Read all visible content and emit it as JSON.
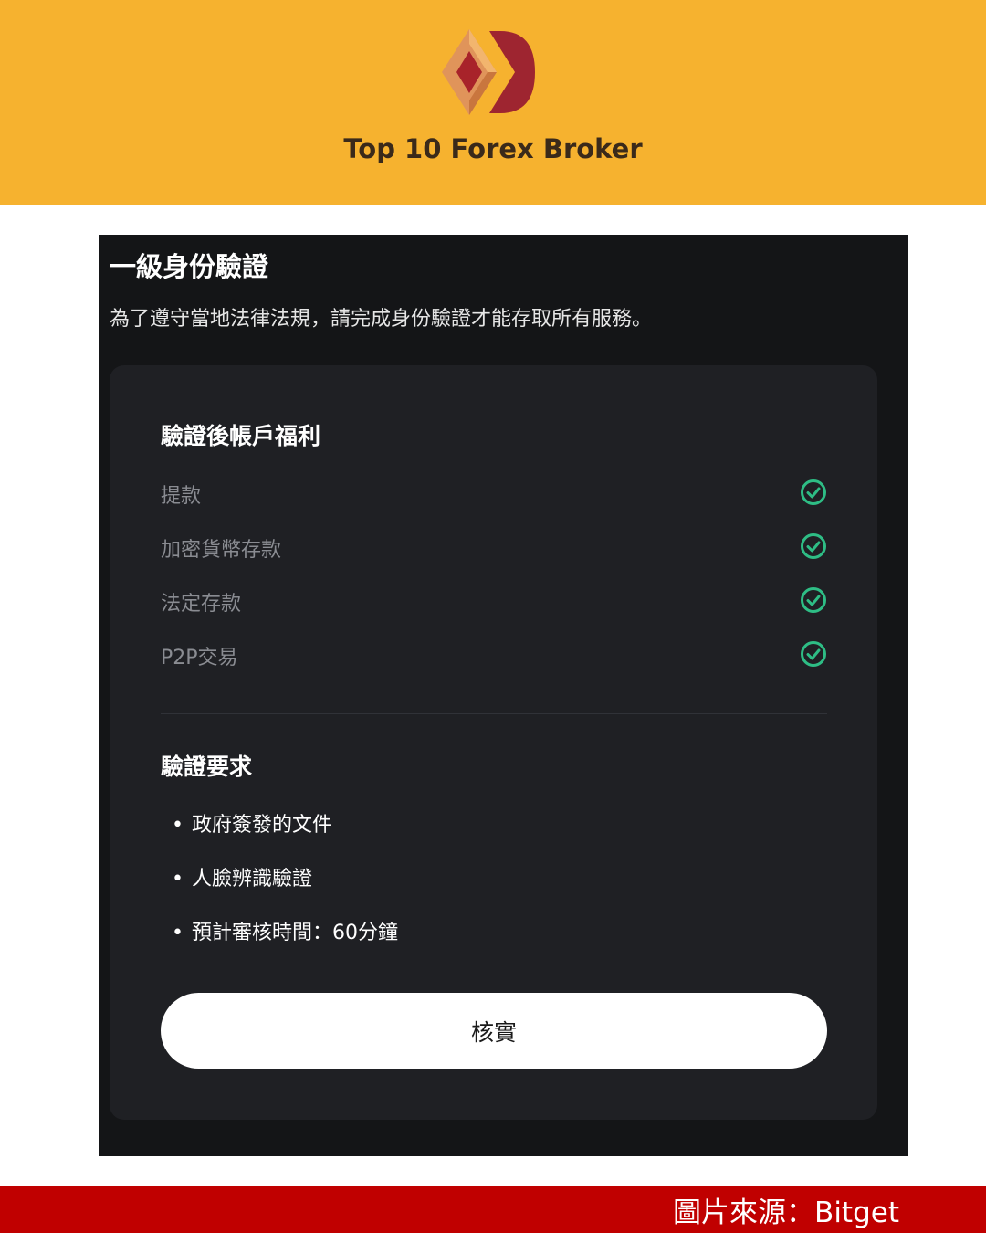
{
  "header": {
    "brand": "Top 10 Forex Broker",
    "logo_icon": "diamond-d-logo",
    "background": "#f6b22f"
  },
  "panel": {
    "title": "一級身份驗證",
    "subtitle": "為了遵守當地法律法規，請完成身份驗證才能存取所有服務。"
  },
  "benefits": {
    "title": "驗證後帳戶福利",
    "items": [
      {
        "label": "提款",
        "icon": "check-circle-icon"
      },
      {
        "label": "加密貨幣存款",
        "icon": "check-circle-icon"
      },
      {
        "label": "法定存款",
        "icon": "check-circle-icon"
      },
      {
        "label": "P2P交易",
        "icon": "check-circle-icon"
      }
    ],
    "check_color": "#2ebd85"
  },
  "requirements": {
    "title": "驗證要求",
    "items": [
      "政府簽發的文件",
      "人臉辨識驗證",
      "預計審核時間：60分鐘"
    ]
  },
  "button": {
    "label": "核實"
  },
  "footer": {
    "credit": "圖片來源：Bitget",
    "background": "#c00000"
  }
}
